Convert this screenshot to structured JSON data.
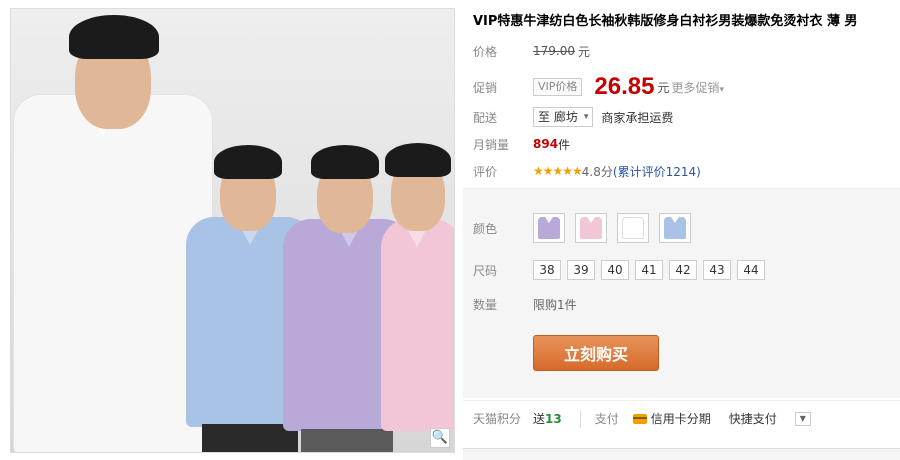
{
  "product": {
    "title": "VIP特惠牛津纺白色长袖秋韩版修身白衬衫男装爆款免烫衬衣 薄 男",
    "zoom_icon": "magnifier-icon",
    "shirt_colors": [
      "#ffffff",
      "#a9c3e6",
      "#b8a9d9",
      "#f2c6d6"
    ]
  },
  "price": {
    "label": "价格",
    "original": "179.00",
    "unit": "元"
  },
  "promo": {
    "label": "促销",
    "badge": "VIP价格",
    "price": "26.85",
    "unit": "元",
    "more": "更多促销",
    "more_arrow": "▾"
  },
  "shipping": {
    "label": "配送",
    "destination": "至 廊坊",
    "caret": "▾",
    "note": "商家承担运费"
  },
  "sales": {
    "label": "月销量",
    "count": "894",
    "unit": "件"
  },
  "rating": {
    "label": "评价",
    "stars": "★★★★★",
    "score": "4.8分",
    "reviews": "(累计评价1214)",
    "star_color": "#f0a000"
  },
  "color": {
    "label": "颜色",
    "swatches": [
      "#b8a9d9",
      "#f2c6d6",
      "#ffffff",
      "#a9c3e6"
    ]
  },
  "size": {
    "label": "尺码",
    "options": [
      "38",
      "39",
      "40",
      "41",
      "42",
      "43",
      "44"
    ]
  },
  "quantity": {
    "label": "数量",
    "limit": "限购1件"
  },
  "buy": {
    "label": "立刻购买",
    "color": "#d76a2a"
  },
  "points": {
    "label": "天猫积分",
    "prefix": "送",
    "value": "13"
  },
  "payment": {
    "label": "支付",
    "credit": "信用卡分期",
    "quick": "快捷支付",
    "more_icon": "chevron-down-icon"
  }
}
